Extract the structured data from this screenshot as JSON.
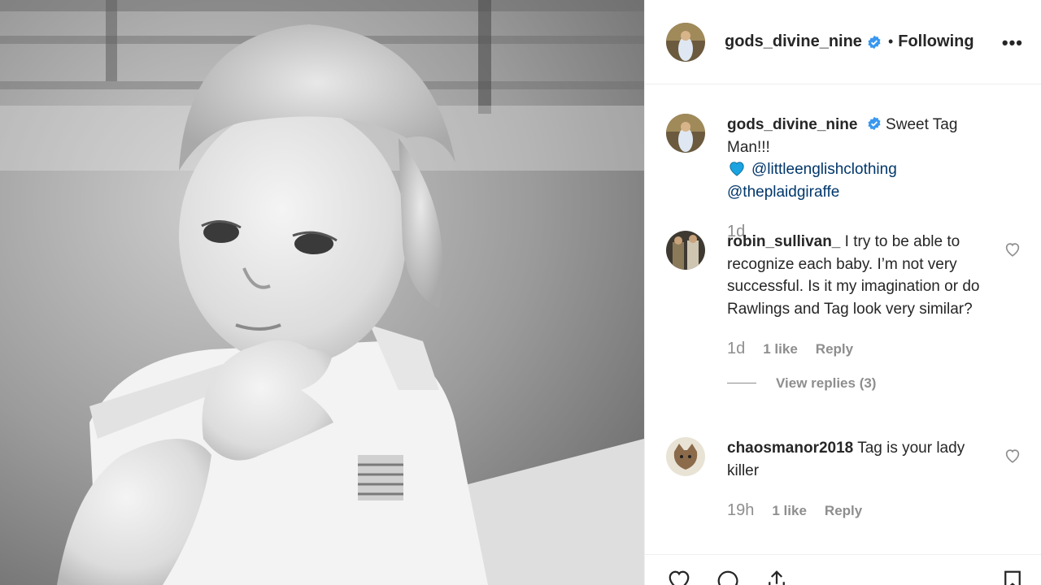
{
  "photo": {
    "alt_icon": "photo-of-toddler"
  },
  "header": {
    "username": "gods_divine_nine",
    "separator": "•",
    "follow_status": "Following",
    "more_icon": "more-options-icon",
    "more_label": "•••"
  },
  "caption": {
    "username": "gods_divine_nine",
    "text": "Sweet Tag Man!!!",
    "emoji": "blue-heart-icon",
    "mention1": "@littleenglishclothing",
    "mention2": "@theplaidgiraffe",
    "time": "1d"
  },
  "comments": [
    {
      "username": "robin_sullivan_",
      "text": "I try to be able to recognize each baby. I’m not very successful. Is it my imagination or do Rawlings and Tag look very similar?",
      "time": "1d",
      "likes": "1 like",
      "reply": "Reply",
      "view_replies": "View replies (3)"
    },
    {
      "username": "chaosmanor2018",
      "text": "Tag is your lady killer",
      "time": "19h",
      "likes": "1 like",
      "reply": "Reply"
    }
  ],
  "actions": [
    "like-icon",
    "comment-icon",
    "share-icon",
    "save-icon"
  ],
  "colors": {
    "mention": "#00376b",
    "verified": "#3897f0",
    "muted": "#8e8e8e",
    "heart": "#1aa3e0"
  }
}
